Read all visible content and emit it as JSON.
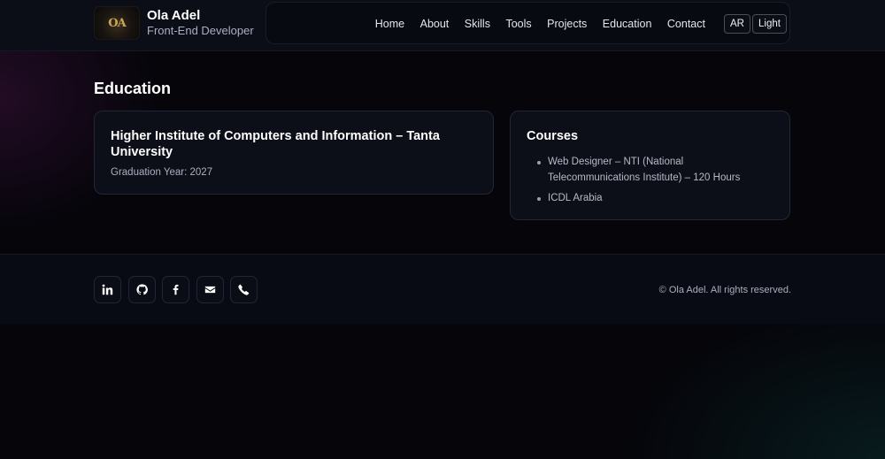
{
  "header": {
    "brand": {
      "logo_text": "OA",
      "name": "Ola Adel",
      "role": "Front-End Developer"
    },
    "nav": [
      "Home",
      "About",
      "Skills",
      "Tools",
      "Projects",
      "Education",
      "Contact"
    ],
    "lang_toggle": "AR",
    "theme_toggle": "Light"
  },
  "education": {
    "title": "Education",
    "degree": {
      "name": "Higher Institute of Computers and Information – Tanta University",
      "graduation": "Graduation Year: 2027"
    },
    "courses": {
      "title": "Courses",
      "items": [
        "Web Designer – NTI (National Telecommunications Institute) – 120 Hours",
        "ICDL Arabia"
      ]
    }
  },
  "footer": {
    "socials": [
      "linkedin-icon",
      "github-icon",
      "facebook-icon",
      "mail-icon",
      "phone-icon"
    ],
    "copyright": "© Ola Adel. All rights reserved."
  }
}
